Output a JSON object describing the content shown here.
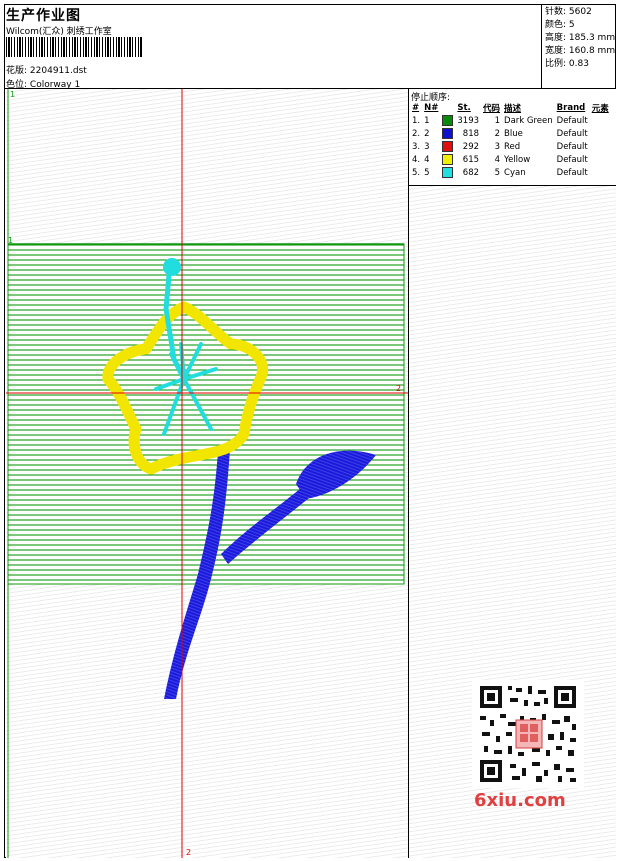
{
  "header": {
    "title": "生产作业图",
    "subtitle": "Wilcom(汇众) 刺绣工作室",
    "design_label": "花版:",
    "design_file": "2204911.dst",
    "colorway_label": "色位:",
    "colorway": "Colorway 1"
  },
  "stats": [
    {
      "label": "针数:",
      "value": "5602"
    },
    {
      "label": "颜色:",
      "value": "5"
    },
    {
      "label": "高度:",
      "value": "185.3 mm"
    },
    {
      "label": "宽度:",
      "value": "160.8 mm"
    },
    {
      "label": "比例:",
      "value": "0.83"
    }
  ],
  "stop_sequence": {
    "title": "停止顺序:",
    "columns": [
      "#",
      "N#",
      "St.",
      "代码",
      "描述",
      "Brand",
      "元素"
    ],
    "rows": [
      {
        "idx": "1.",
        "n": "1",
        "color": "#0a8a0a",
        "st": "3193",
        "code": "1",
        "desc": "Dark Green",
        "brand": "Default"
      },
      {
        "idx": "2.",
        "n": "2",
        "color": "#1010d0",
        "st": "818",
        "code": "2",
        "desc": "Blue",
        "brand": "Default"
      },
      {
        "idx": "3.",
        "n": "3",
        "color": "#e01010",
        "st": "292",
        "code": "3",
        "desc": "Red",
        "brand": "Default"
      },
      {
        "idx": "4.",
        "n": "4",
        "color": "#f0f000",
        "st": "615",
        "code": "4",
        "desc": "Yellow",
        "brand": "Default"
      },
      {
        "idx": "5.",
        "n": "5",
        "color": "#20e0e0",
        "st": "682",
        "code": "5",
        "desc": "Cyan",
        "brand": "Default"
      }
    ]
  },
  "canvas": {
    "markers": [
      "1",
      "1",
      "2",
      "2"
    ]
  },
  "watermark": "6xiu.com",
  "colors": {
    "green": "#119911",
    "blue": "#1a1adc",
    "yellow": "#f2e600",
    "cyan": "#22dddd",
    "red_guide": "#e00000"
  }
}
